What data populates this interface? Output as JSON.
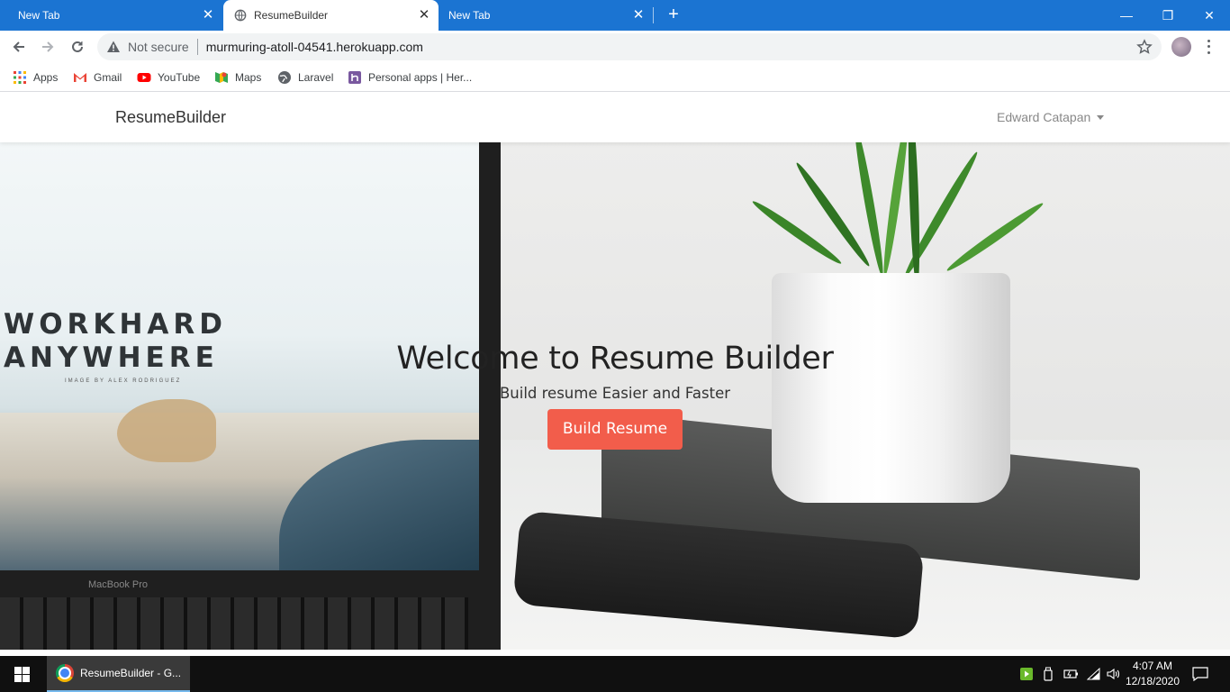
{
  "browser": {
    "tabs": [
      {
        "label": "New Tab",
        "active": false
      },
      {
        "label": "ResumeBuilder",
        "active": true
      },
      {
        "label": "New Tab",
        "active": false
      }
    ],
    "new_tab_label": "+",
    "window_controls": {
      "minimize": "—",
      "restore": "❐",
      "close": "✕"
    },
    "security_label": "Not secure",
    "url": "murmuring-atoll-04541.herokuapp.com",
    "bookmarks": [
      {
        "label": "Apps",
        "icon": "apps-grid-icon"
      },
      {
        "label": "Gmail",
        "icon": "gmail-icon"
      },
      {
        "label": "YouTube",
        "icon": "youtube-icon"
      },
      {
        "label": "Maps",
        "icon": "maps-icon"
      },
      {
        "label": "Laravel",
        "icon": "globe-icon"
      },
      {
        "label": "Personal apps | Her...",
        "icon": "heroku-icon"
      }
    ]
  },
  "site": {
    "brand": "ResumeBuilder",
    "user_name": "Edward Catapan",
    "hero": {
      "title": "Welcome to Resume Builder",
      "subtitle": "Build resume Easier and Faster",
      "cta_label": "Build Resume"
    },
    "hero_image_text": {
      "line1": "WORKHARD",
      "line2": "ANYWHERE",
      "credit": "IMAGE BY ALEX RODRIGUEZ",
      "laptop_model": "MacBook Pro"
    },
    "colors": {
      "cta": "#f25d4b",
      "tab_strip": "#1b74d2"
    }
  },
  "taskbar": {
    "app_label": "ResumeBuilder - G...",
    "time": "4:07 AM",
    "date": "12/18/2020"
  }
}
